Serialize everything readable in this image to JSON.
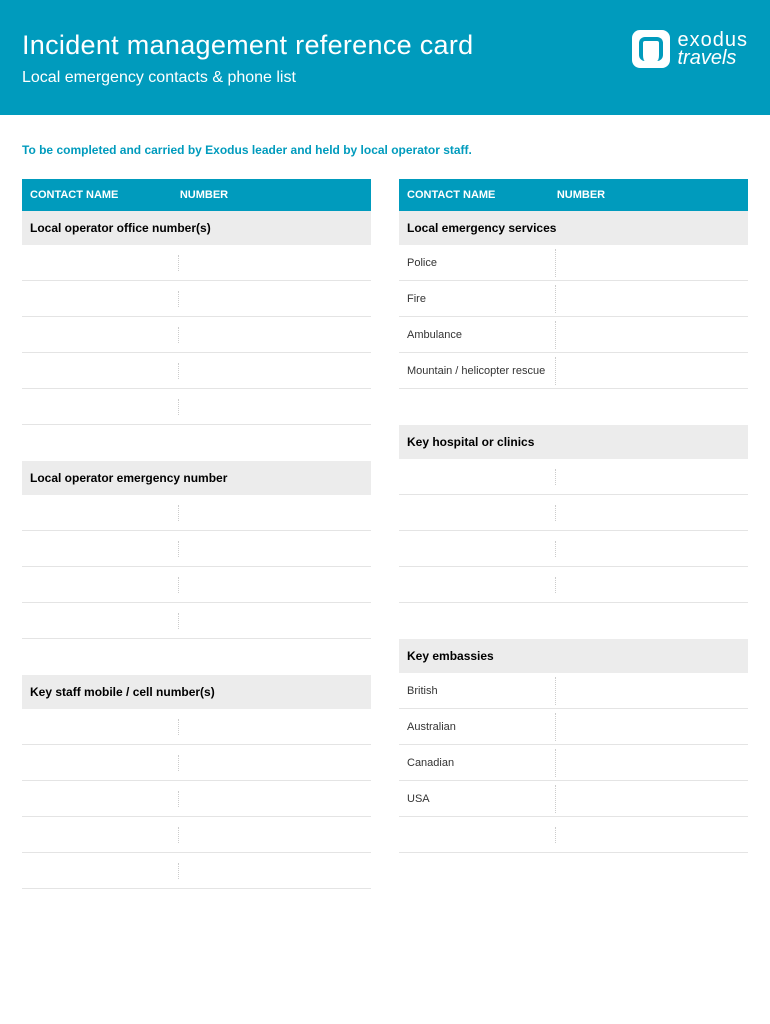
{
  "header": {
    "title": "Incident management reference card",
    "subtitle": "Local emergency contacts & phone list",
    "logo_line1": "exodus",
    "logo_line2": "travels"
  },
  "instruction": "To be completed and carried by Exodus leader and held by local operator staff.",
  "table_headers": {
    "name": "CONTACT NAME",
    "number": "NUMBER"
  },
  "left_sections": [
    {
      "title": "Local operator office number(s)",
      "rows": [
        "",
        "",
        "",
        "",
        ""
      ]
    },
    {
      "title": "Local operator emergency number",
      "rows": [
        "",
        "",
        "",
        ""
      ]
    },
    {
      "title": "Key staff mobile / cell number(s)",
      "rows": [
        "",
        "",
        "",
        "",
        ""
      ]
    }
  ],
  "right_sections": [
    {
      "title": "Local emergency services",
      "rows": [
        "Police",
        "Fire",
        "Ambulance",
        "Mountain / helicopter rescue"
      ]
    },
    {
      "title": "Key hospital or clinics",
      "rows": [
        "",
        "",
        "",
        ""
      ]
    },
    {
      "title": "Key embassies",
      "rows": [
        "British",
        "Australian",
        "Canadian",
        "USA",
        ""
      ]
    }
  ]
}
